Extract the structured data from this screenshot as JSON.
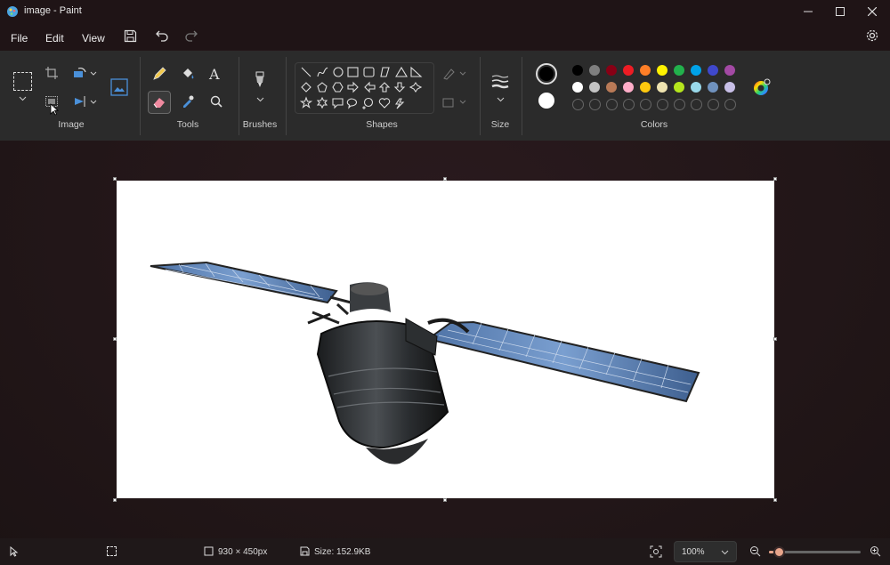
{
  "window": {
    "title": "image - Paint"
  },
  "menu": {
    "file": "File",
    "edit": "Edit",
    "view": "View"
  },
  "ribbon": {
    "groups": {
      "image": "Image",
      "tools": "Tools",
      "brushes": "Brushes",
      "shapes": "Shapes",
      "size": "Size",
      "colors": "Colors"
    }
  },
  "colors": {
    "primary": "#000000",
    "secondary": "#ffffff",
    "row1": [
      "#000000",
      "#7f7f7f",
      "#880015",
      "#ed1c24",
      "#ff7f27",
      "#fff200",
      "#ffd700",
      "#22b14c",
      "#00a2e8",
      "#3f48cc",
      "#a349a4"
    ],
    "row2": [
      "#ffffff",
      "#c3c3c3",
      "#b97a57",
      "#ffaec9",
      "#ffc90e",
      "#efe4b0",
      "#b5e61d",
      "#99d9ea",
      "#7092be",
      "#c8bfe7"
    ]
  },
  "status": {
    "dimensions": "930 × 450px",
    "size": "Size: 152.9KB",
    "zoom": "100%"
  },
  "zoom_slider": {
    "value_fraction": 0.05
  }
}
